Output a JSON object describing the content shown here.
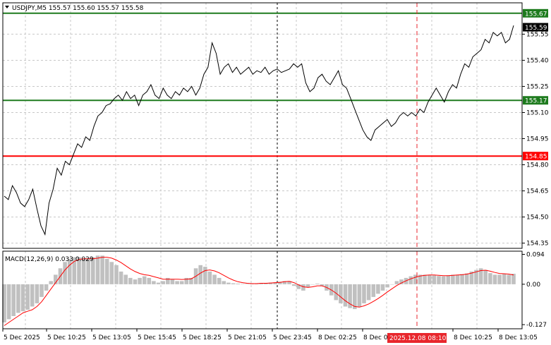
{
  "header": {
    "symbol_line": "USDJPY,M5  155.57 155.60 155.57 155.58",
    "macd_label": "MACD(12,26,9) 0.033 0.029"
  },
  "colors": {
    "support_resistance": "#1e7b1e",
    "red_level": "#ff0000",
    "price_line": "#000000",
    "histogram": "#c0c0c0",
    "signal_line": "#ff0000",
    "grid": "#c8c8c8",
    "crosshair_label_bg": "#e8262c"
  },
  "chart_data": [
    {
      "type": "line",
      "name": "price",
      "y_range": [
        154.32,
        155.73
      ],
      "y_ticks": [
        155.55,
        155.4,
        155.25,
        155.1,
        154.95,
        154.8,
        154.65,
        154.5,
        154.35
      ],
      "y_tick_labels": [
        "155.55",
        "155.40",
        "155.25",
        "155.10",
        "154.95",
        "154.80",
        "154.65",
        "154.50",
        "154.35"
      ],
      "x_tick_labels": [
        "5 Dec 2025",
        "5 Dec 10:25",
        "5 Dec 13:05",
        "5 Dec 15:45",
        "5 Dec 18:25",
        "5 Dec 21:05",
        "5 Dec 23:45",
        "8 Dec 02:25",
        "8 Dec 05:05",
        "8 Dec 10:25",
        "8 Dec 13:05"
      ],
      "horizontal_levels": [
        {
          "value": 155.67,
          "label": "155.67",
          "color": "#1e7b1e"
        },
        {
          "value": 155.17,
          "label": "155.17",
          "color": "#1e7b1e"
        },
        {
          "value": 154.85,
          "label": "154.85",
          "color": "#ff0000"
        }
      ],
      "current_price": {
        "value": 155.59,
        "label": "155.59"
      },
      "y": [
        154.62,
        154.6,
        154.68,
        154.64,
        154.58,
        154.56,
        154.6,
        154.66,
        154.55,
        154.45,
        154.4,
        154.58,
        154.66,
        154.78,
        154.74,
        154.82,
        154.8,
        154.86,
        154.92,
        154.9,
        154.96,
        154.94,
        155.02,
        155.08,
        155.1,
        155.14,
        155.15,
        155.18,
        155.2,
        155.17,
        155.22,
        155.18,
        155.2,
        155.14,
        155.2,
        155.22,
        155.26,
        155.2,
        155.18,
        155.24,
        155.2,
        155.18,
        155.22,
        155.2,
        155.24,
        155.22,
        155.25,
        155.2,
        155.24,
        155.32,
        155.36,
        155.5,
        155.44,
        155.32,
        155.36,
        155.38,
        155.33,
        155.36,
        155.32,
        155.34,
        155.36,
        155.32,
        155.34,
        155.33,
        155.36,
        155.32,
        155.34,
        155.35,
        155.33,
        155.34,
        155.35,
        155.38,
        155.36,
        155.38,
        155.27,
        155.22,
        155.24,
        155.3,
        155.32,
        155.28,
        155.26,
        155.3,
        155.34,
        155.26,
        155.24,
        155.18,
        155.12,
        155.06,
        155.0,
        154.96,
        154.94,
        155.0,
        155.02,
        155.04,
        155.06,
        155.02,
        155.04,
        155.08,
        155.1,
        155.08,
        155.1,
        155.08,
        155.12,
        155.1,
        155.16,
        155.2,
        155.24,
        155.2,
        155.16,
        155.22,
        155.26,
        155.24,
        155.32,
        155.38,
        155.36,
        155.42,
        155.44,
        155.46,
        155.52,
        155.5,
        155.56,
        155.54,
        155.56,
        155.5,
        155.52,
        155.6
      ]
    },
    {
      "type": "bar",
      "name": "MACD(12,26,9)",
      "y_range": [
        -0.14,
        0.104
      ],
      "y_ticks": [
        0.094,
        0.0,
        -0.127
      ],
      "y_tick_labels": [
        "0.094",
        "0.00",
        "-0.127"
      ],
      "values": [
        -0.12,
        -0.11,
        -0.1,
        -0.09,
        -0.085,
        -0.08,
        -0.07,
        -0.06,
        -0.04,
        -0.02,
        0.01,
        0.03,
        0.05,
        0.07,
        0.08,
        0.085,
        0.085,
        0.08,
        0.08,
        0.085,
        0.09,
        0.09,
        0.08,
        0.07,
        0.06,
        0.04,
        0.03,
        0.02,
        0.015,
        0.02,
        0.025,
        0.02,
        0.01,
        0.005,
        0.01,
        0.02,
        0.015,
        0.01,
        0.01,
        0.02,
        0.02,
        0.05,
        0.06,
        0.055,
        0.04,
        0.03,
        0.02,
        0.01,
        0.005,
        0.003,
        0.002,
        0.001,
        0.001,
        0.002,
        0.003,
        0.004,
        0.004,
        0.005,
        0.006,
        0.008,
        0.01,
        0.01,
        -0.005,
        -0.015,
        -0.02,
        -0.01,
        0.0,
        0.002,
        -0.005,
        -0.02,
        -0.035,
        -0.05,
        -0.06,
        -0.07,
        -0.075,
        -0.078,
        -0.072,
        -0.06,
        -0.05,
        -0.04,
        -0.03,
        -0.02,
        -0.01,
        0.0,
        0.01,
        0.015,
        0.02,
        0.025,
        0.03,
        0.03,
        0.03,
        0.03,
        0.028,
        0.026,
        0.025,
        0.028,
        0.03,
        0.03,
        0.032,
        0.034,
        0.04,
        0.045,
        0.05,
        0.045,
        0.035,
        0.03,
        0.03,
        0.032,
        0.03,
        0.033
      ],
      "signal": [
        -0.13,
        -0.12,
        -0.11,
        -0.1,
        -0.09,
        -0.085,
        -0.08,
        -0.07,
        -0.055,
        -0.035,
        -0.015,
        0.005,
        0.025,
        0.045,
        0.06,
        0.072,
        0.078,
        0.08,
        0.08,
        0.08,
        0.082,
        0.085,
        0.085,
        0.082,
        0.076,
        0.068,
        0.058,
        0.048,
        0.04,
        0.034,
        0.03,
        0.028,
        0.024,
        0.02,
        0.016,
        0.016,
        0.016,
        0.016,
        0.015,
        0.016,
        0.017,
        0.025,
        0.035,
        0.043,
        0.045,
        0.042,
        0.036,
        0.028,
        0.02,
        0.013,
        0.008,
        0.005,
        0.003,
        0.002,
        0.002,
        0.003,
        0.003,
        0.004,
        0.005,
        0.006,
        0.008,
        0.009,
        0.005,
        -0.002,
        -0.008,
        -0.01,
        -0.008,
        -0.005,
        -0.005,
        -0.01,
        -0.018,
        -0.028,
        -0.04,
        -0.052,
        -0.062,
        -0.07,
        -0.072,
        -0.068,
        -0.062,
        -0.054,
        -0.045,
        -0.035,
        -0.024,
        -0.014,
        -0.004,
        0.004,
        0.011,
        0.017,
        0.022,
        0.026,
        0.028,
        0.029,
        0.029,
        0.028,
        0.027,
        0.027,
        0.028,
        0.029,
        0.03,
        0.032,
        0.035,
        0.039,
        0.043,
        0.044,
        0.041,
        0.037,
        0.034,
        0.033,
        0.032,
        0.029
      ]
    }
  ],
  "crosshair": {
    "time_label": "2025.12.08 08:10"
  }
}
